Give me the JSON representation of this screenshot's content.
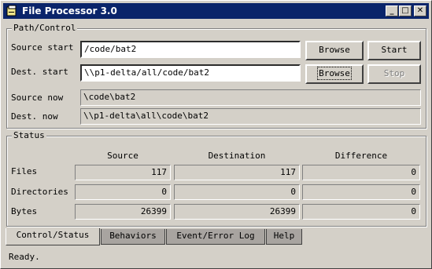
{
  "window": {
    "title": "File Processor 3.0",
    "minimize": "_",
    "maximize": "□",
    "close": "✕"
  },
  "path_control": {
    "legend": "Path/Control",
    "source_start_label": "Source start",
    "source_start_value": "/code/bat2",
    "dest_start_label": "Dest. start",
    "dest_start_value": "\\\\p1-delta/all/code/bat2",
    "source_now_label": "Source now",
    "source_now_value": "\\code\\bat2",
    "dest_now_label": "Dest. now",
    "dest_now_value": "\\\\p1-delta\\all\\code\\bat2",
    "browse_label": "Browse",
    "start_label": "Start",
    "stop_label": "Stop"
  },
  "status": {
    "legend": "Status",
    "columns": [
      "Source",
      "Destination",
      "Difference"
    ],
    "rows": [
      {
        "label": "Files",
        "values": [
          "117",
          "117",
          "0"
        ]
      },
      {
        "label": "Directories",
        "values": [
          "0",
          "0",
          "0"
        ]
      },
      {
        "label": "Bytes",
        "values": [
          "26399",
          "26399",
          "0"
        ]
      }
    ]
  },
  "tabs": [
    "Control/Status",
    "Behaviors",
    "Event/Error Log",
    "Help"
  ],
  "statusbar": {
    "text": "Ready."
  }
}
